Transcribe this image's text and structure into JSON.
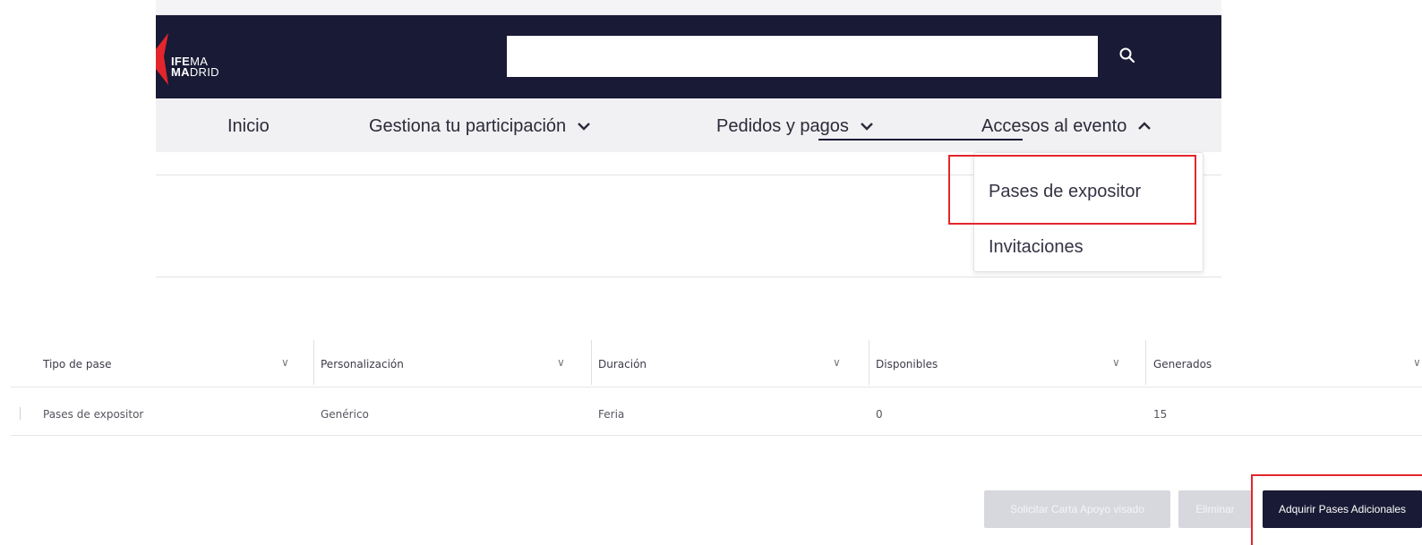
{
  "brand": {
    "logo_line1_bold": "IFE",
    "logo_line1_rest": "MA",
    "logo_line2_bold": "MA",
    "logo_line2_rest": "DRID",
    "accent_color": "#e3262c",
    "header_color": "#191a35"
  },
  "search": {
    "value": "",
    "placeholder": "",
    "icon": "search-icon"
  },
  "nav": {
    "items": [
      {
        "label": "Inicio",
        "icon": ""
      },
      {
        "label": "Gestiona tu participación",
        "icon": "chevron-down-icon"
      },
      {
        "label": "Pedidos y pagos",
        "icon": "chevron-down-icon"
      },
      {
        "label": "Accesos al evento",
        "icon": "chevron-up-icon",
        "active": true
      }
    ]
  },
  "dropdown": {
    "items": [
      {
        "label": "Pases de expositor",
        "highlighted": true
      },
      {
        "label": "Invitaciones"
      }
    ]
  },
  "table": {
    "columns": [
      "Tipo de pase",
      "Personalización",
      "Duración",
      "Disponibles",
      "Generados"
    ],
    "rows": [
      [
        "Pases de expositor",
        "Genérico",
        "Feria",
        "0",
        "15"
      ]
    ]
  },
  "actions": {
    "buttons": [
      {
        "label": "Solicitar Carta Apoyo visado",
        "state": "disabled"
      },
      {
        "label": "Eliminar",
        "state": "disabled"
      },
      {
        "label": "Adquirir Pases Adicionales",
        "state": "primary",
        "highlighted": true
      }
    ]
  }
}
